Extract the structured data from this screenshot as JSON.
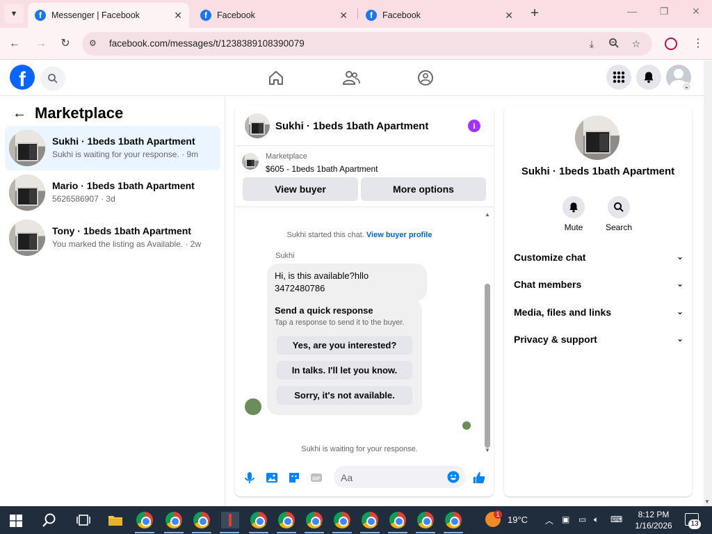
{
  "browser": {
    "tabs": [
      {
        "title": "Messenger | Facebook",
        "active": true
      },
      {
        "title": "Facebook",
        "active": false
      },
      {
        "title": "Facebook",
        "active": false
      }
    ],
    "url": "facebook.com/messages/t/1238389108390079"
  },
  "left_pane": {
    "title": "Marketplace",
    "conversations": [
      {
        "name": "Sukhi · 1beds 1bath Apartment",
        "preview": "Sukhi is waiting for your response. · 9m",
        "active": true
      },
      {
        "name": "Mario · 1beds 1bath Apartment",
        "preview": "5626586907 · 3d",
        "active": false
      },
      {
        "name": "Tony · 1beds 1bath Apartment",
        "preview": "You marked the listing as Available. · 2w",
        "active": false
      }
    ]
  },
  "chat": {
    "title": "Sukhi · 1beds 1bath Apartment",
    "listing_label": "Marketplace",
    "listing_price": "$605 - 1beds 1bath Apartment",
    "view_buyer": "View buyer",
    "more_options": "More options",
    "started_text": "Sukhi started this chat.",
    "view_profile_link": "View buyer profile",
    "sender": "Sukhi",
    "message": "Hi, is this available?hllo 3472480786",
    "quick_title": "Send a quick response",
    "quick_sub": "Tap a response to send it to the buyer.",
    "quick_responses": [
      "Yes, are you interested?",
      "In talks. I'll let you know.",
      "Sorry, it's not available."
    ],
    "waiting_text": "Sukhi is waiting for your response.",
    "input_placeholder": "Aa"
  },
  "right_pane": {
    "name": "Sukhi · 1beds 1bath Apartment",
    "actions": [
      "Mute",
      "Search"
    ],
    "sections": [
      "Customize chat",
      "Chat members",
      "Media, files and links",
      "Privacy & support"
    ]
  },
  "taskbar": {
    "weather": "19°C",
    "time": "8:12 PM",
    "date": "1/16/2026",
    "notifications": "13",
    "weather_badge": "1"
  },
  "colors": {
    "facebook_blue": "#0866ff",
    "messenger_blue": "#0084ff",
    "info_purple": "#a033ff",
    "active_row": "#ebf5ff",
    "tab_strip": "#f9dfe3"
  }
}
